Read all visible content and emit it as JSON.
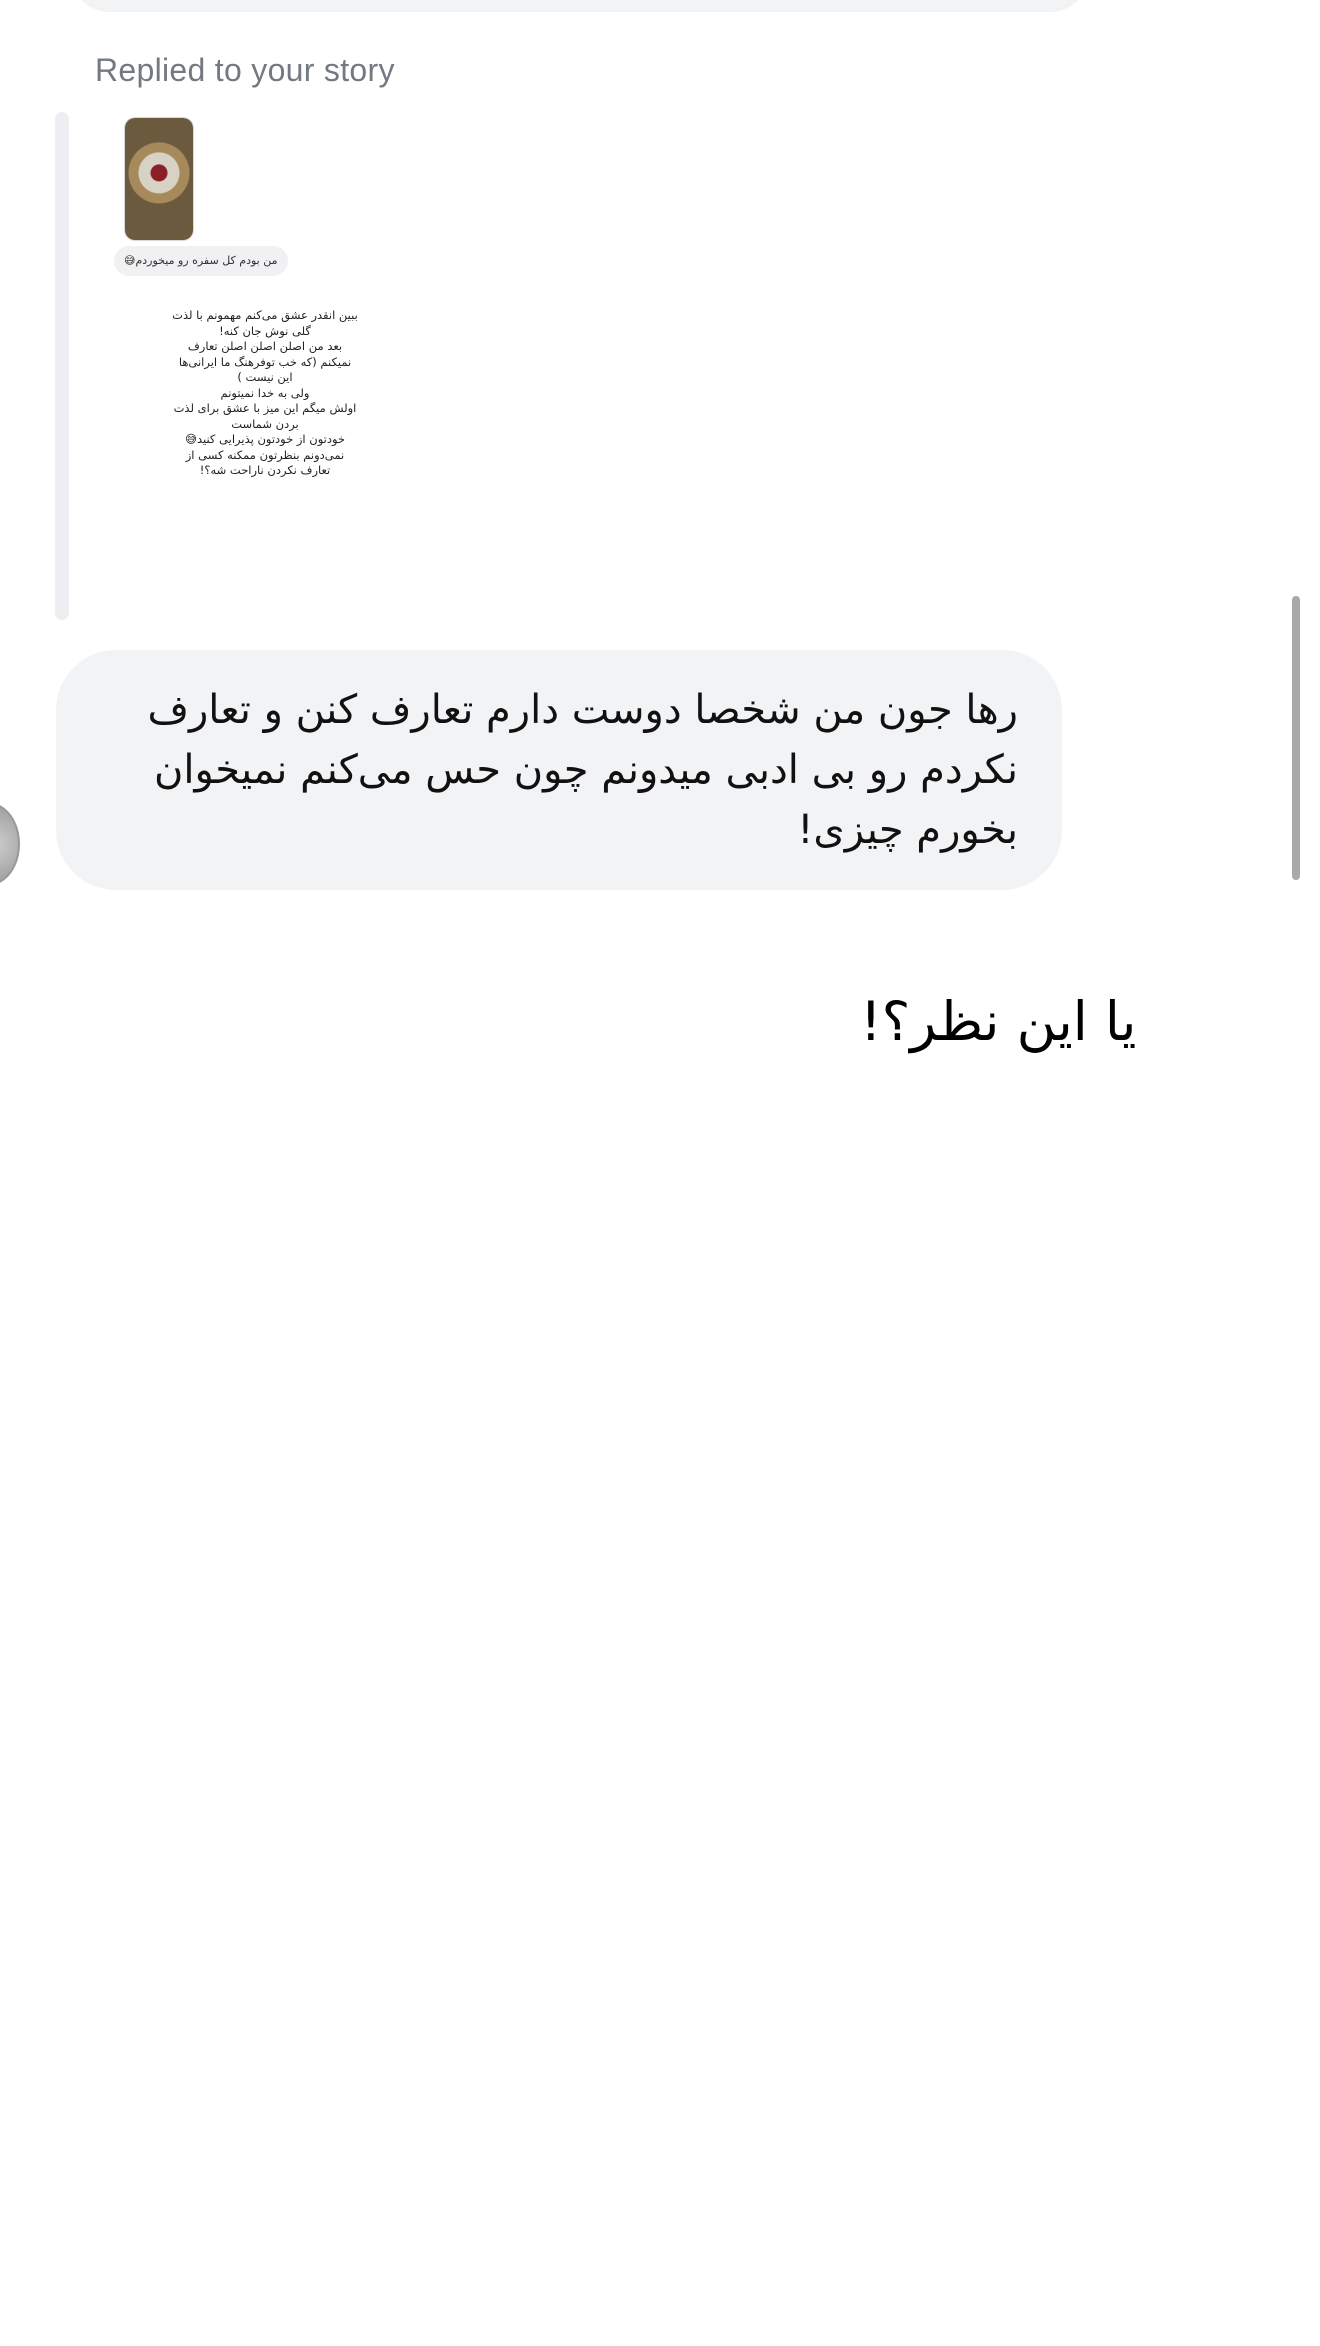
{
  "reply_label": "Replied to your story",
  "story": {
    "sticker_text": "من بودم کل سفره رو میخوردم😅",
    "text": "ببین انقدر عشق می‌کنم مهمونم با لذت\nگلی نوش جان کنه!\nبعد من اصلن اصلن اصلن تعارف\nنمیکنم (که خب توفرهنگ ما ایرانی‌ها\nاین نیست )\nولی به خدا نمیتونم\nاولش میگم این میز با عشق برای لذت\nبردن شماست\nخودتون از خودتون پذیرایی کنید😅\nنمی‌دونم بنظرتون ممکنه کسی از\nتعارف نکردن ناراحت شه؟!"
  },
  "message": {
    "text": "رها جون من شخصا دوست دارم تعارف کنن و تعارف نکردم رو بی ادبی میدونم چون حس می‌کنم نمیخوان بخورم چیزی!"
  },
  "caption": "یا این نظر؟!",
  "colors": {
    "bubble_bg": "#f2f3f5",
    "label_gray": "#737983",
    "scrollbar": "#a9a9a9"
  },
  "icons": {
    "avatar": "profile-avatar-partial"
  }
}
